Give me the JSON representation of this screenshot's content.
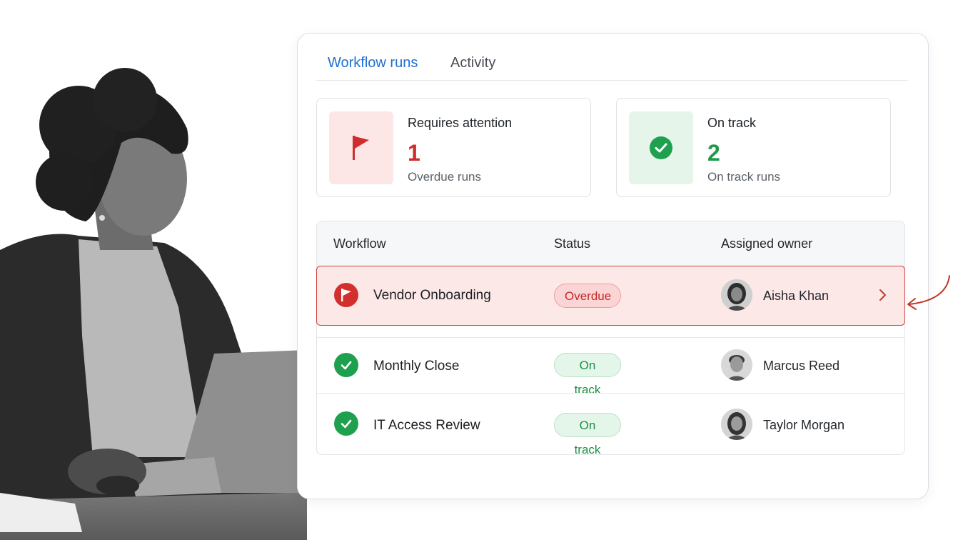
{
  "tabs": [
    {
      "label": "Workflow runs",
      "active": true
    },
    {
      "label": "Activity",
      "active": false
    }
  ],
  "summary": {
    "attention": {
      "title": "Requires attention",
      "count": "1",
      "subtitle": "Overdue runs",
      "icon": "flag-icon",
      "color": "#d12b2b"
    },
    "on_track": {
      "title": "On track",
      "count": "2",
      "subtitle": "On track runs",
      "icon": "check-circle-icon",
      "color": "#1f9a4b"
    }
  },
  "table": {
    "headers": {
      "workflow": "Workflow",
      "status": "Status",
      "owner": "Assigned owner"
    },
    "rows": [
      {
        "workflow": "Vendor Onboarding",
        "status": "Overdue",
        "owner": "Aisha Khan",
        "highlighted": true,
        "icon": "flag-icon"
      },
      {
        "workflow": "Monthly Close",
        "status": "On track",
        "owner": "Marcus Reed",
        "highlighted": false,
        "icon": "check-circle-icon"
      },
      {
        "workflow": "IT Access Review",
        "status": "On track",
        "owner": "Taylor Morgan",
        "highlighted": false,
        "icon": "check-circle-icon"
      }
    ]
  },
  "colors": {
    "accent": "#1f6fd1",
    "overdue": "#d32f2f",
    "on_track": "#1fa04e"
  }
}
